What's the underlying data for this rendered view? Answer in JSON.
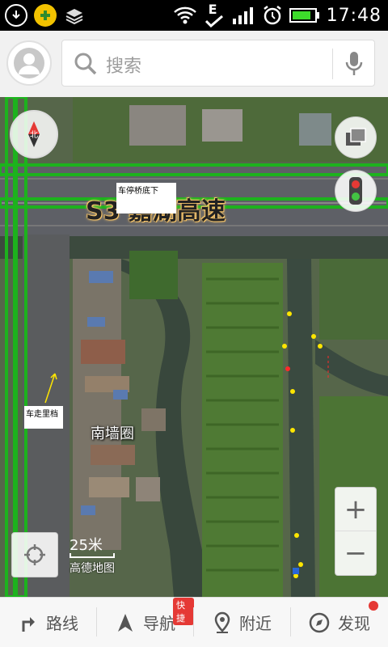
{
  "status": {
    "time": "17:48",
    "network": "E"
  },
  "search": {
    "placeholder": "搜索"
  },
  "map": {
    "road_label": "S3 嘉湖高速",
    "note_top": "车停桥底下",
    "note_left": "车走里档",
    "poi": "南墙圈",
    "scale": "25米",
    "brand": "高德地图"
  },
  "nav": {
    "route": "路线",
    "navigate": "导航",
    "navigate_badge": "快捷",
    "nearby": "附近",
    "discover": "发现"
  },
  "colors": {
    "accent": "#2e7d32",
    "route_green": "#1db21d",
    "badge_red": "#e53935"
  }
}
